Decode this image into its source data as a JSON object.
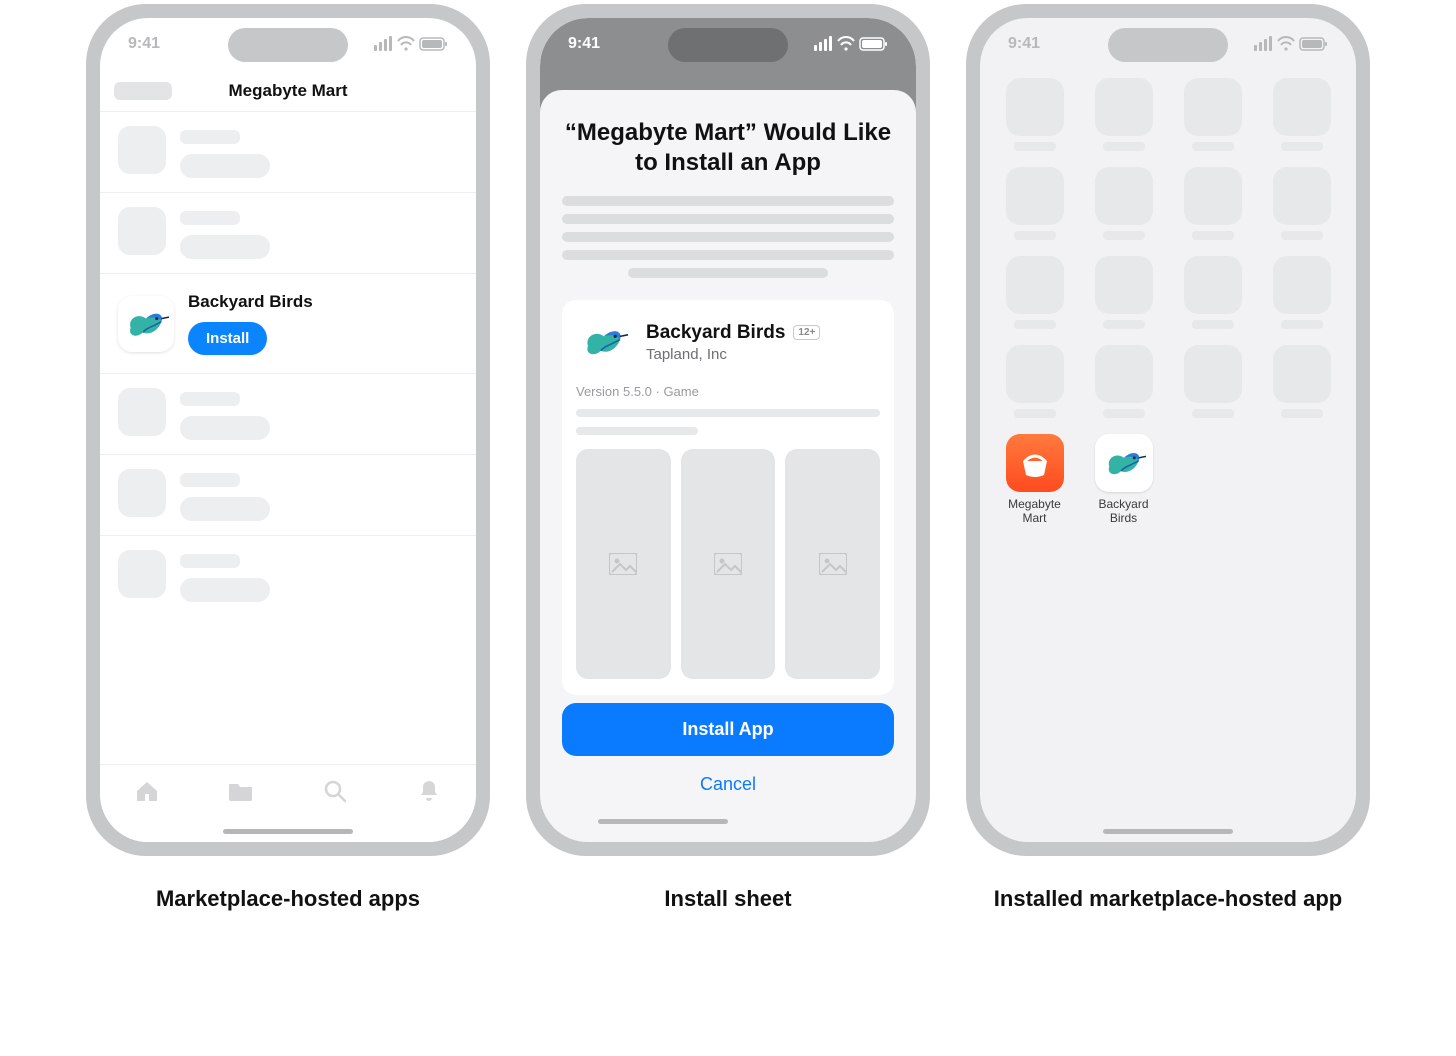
{
  "status": {
    "time": "9:41"
  },
  "screen1": {
    "nav_title": "Megabyte Mart",
    "app_name": "Backyard Birds",
    "install_label": "Install",
    "caption": "Marketplace-hosted apps",
    "tabs": [
      "home-icon",
      "folder-icon",
      "search-icon",
      "bell-icon"
    ]
  },
  "screen2": {
    "sheet_title": "“Megabyte Mart” Would Like to Install an App",
    "app_name": "Backyard Birds",
    "publisher": "Tapland, Inc",
    "age_rating": "12+",
    "meta": "Version 5.5.0 · Game",
    "install_label": "Install App",
    "cancel_label": "Cancel",
    "caption": "Install sheet"
  },
  "screen3": {
    "apps": [
      {
        "id": "megabyte-mart",
        "label": "Megabyte Mart"
      },
      {
        "id": "backyard-birds",
        "label": "Backyard Birds"
      }
    ],
    "caption": "Installed marketplace-hosted app"
  }
}
